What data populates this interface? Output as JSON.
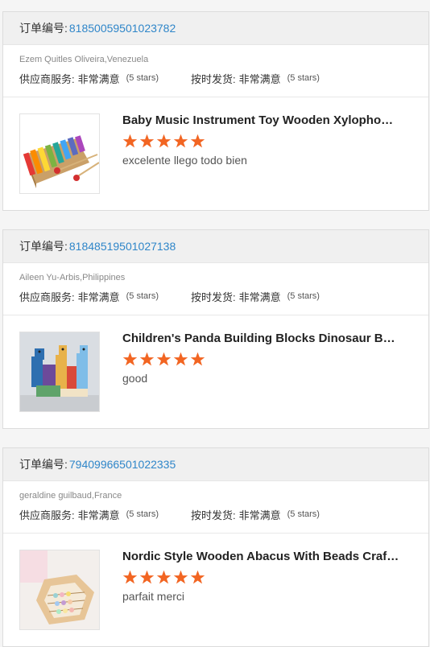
{
  "orders": [
    {
      "order_label": "订单编号:",
      "order_number": "81850059501023782",
      "buyer": "Ezem Quitles Oliveira,Venezuela",
      "supplier_label": "供应商服务:",
      "supplier_value": "非常满意",
      "supplier_stars": "(5 stars)",
      "shipping_label": "按时发货:",
      "shipping_value": "非常满意",
      "shipping_stars": "(5 stars)",
      "product_title": "Baby Music Instrument Toy Wooden Xylophone...",
      "rating": 5,
      "review": "excelente llego todo bien",
      "image_icon": "xylophone-image"
    },
    {
      "order_label": "订单编号:",
      "order_number": "81848519501027138",
      "buyer": "Aileen Yu-Arbis,Philippines",
      "supplier_label": "供应商服务:",
      "supplier_value": "非常满意",
      "supplier_stars": "(5 stars)",
      "shipping_label": "按时发货:",
      "shipping_value": "非常满意",
      "shipping_stars": "(5 stars)",
      "product_title": "Children's Panda Building Blocks Dinosaur Bala...",
      "rating": 5,
      "review": "good",
      "image_icon": "dinosaur-blocks-image"
    },
    {
      "order_label": "订单编号:",
      "order_number": "79409966501022335",
      "buyer": "geraldine guilbaud,France",
      "supplier_label": "供应商服务:",
      "supplier_value": "非常满意",
      "supplier_stars": "(5 stars)",
      "shipping_label": "按时发货:",
      "shipping_value": "非常满意",
      "shipping_stars": "(5 stars)",
      "product_title": "Nordic Style Wooden Abacus With Beads Craft ...",
      "rating": 5,
      "review": "parfait merci",
      "image_icon": "abacus-image"
    }
  ],
  "colors": {
    "star": "#f26522",
    "link": "#2f86c9"
  }
}
